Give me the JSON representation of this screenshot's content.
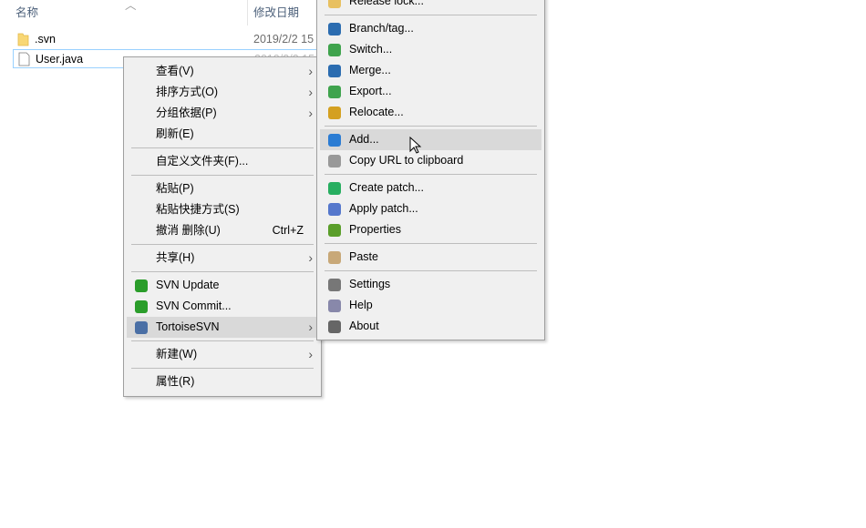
{
  "explorer": {
    "columns": [
      "名称",
      "修改日期"
    ],
    "files": [
      {
        "name": ".svn",
        "date": "2019/2/2 15"
      },
      {
        "name": "User.java",
        "date": "2019/2/2 15"
      }
    ]
  },
  "context_menu": {
    "items": [
      {
        "label": "查看(V)",
        "submenu": true
      },
      {
        "label": "排序方式(O)",
        "submenu": true
      },
      {
        "label": "分组依据(P)",
        "submenu": true
      },
      {
        "label": "刷新(E)"
      },
      {
        "label": "自定义文件夹(F)..."
      },
      {
        "label": "粘贴(P)"
      },
      {
        "label": "粘贴快捷方式(S)"
      },
      {
        "label": "撤消 删除(U)",
        "shortcut": "Ctrl+Z"
      },
      {
        "label": "共享(H)",
        "submenu": true
      },
      {
        "label": "SVN Update",
        "icon": "svn-update-icon"
      },
      {
        "label": "SVN Commit...",
        "icon": "svn-commit-icon"
      },
      {
        "label": "TortoiseSVN",
        "icon": "tortoisesvn-icon",
        "submenu": true,
        "highlighted": true
      },
      {
        "label": "新建(W)",
        "submenu": true
      },
      {
        "label": "属性(R)"
      }
    ]
  },
  "svn_submenu": {
    "items": [
      {
        "label": "Release lock...",
        "icon": "lock-icon"
      },
      {
        "label": "Branch/tag...",
        "icon": "branch-icon"
      },
      {
        "label": "Switch...",
        "icon": "switch-icon"
      },
      {
        "label": "Merge...",
        "icon": "merge-icon"
      },
      {
        "label": "Export...",
        "icon": "export-icon"
      },
      {
        "label": "Relocate...",
        "icon": "relocate-icon"
      },
      {
        "label": "Add...",
        "icon": "add-icon",
        "highlighted": true
      },
      {
        "label": "Copy URL to clipboard",
        "icon": "copy-url-icon"
      },
      {
        "label": "Create patch...",
        "icon": "create-patch-icon"
      },
      {
        "label": "Apply patch...",
        "icon": "apply-patch-icon"
      },
      {
        "label": "Properties",
        "icon": "properties-icon"
      },
      {
        "label": "Paste",
        "icon": "paste-icon"
      },
      {
        "label": "Settings",
        "icon": "settings-icon"
      },
      {
        "label": "Help",
        "icon": "help-icon"
      },
      {
        "label": "About",
        "icon": "about-icon"
      }
    ]
  },
  "colors": {
    "highlight": "#d9d9d9",
    "menu_bg": "#f0f0f0",
    "selection_border": "#99d1ff"
  }
}
